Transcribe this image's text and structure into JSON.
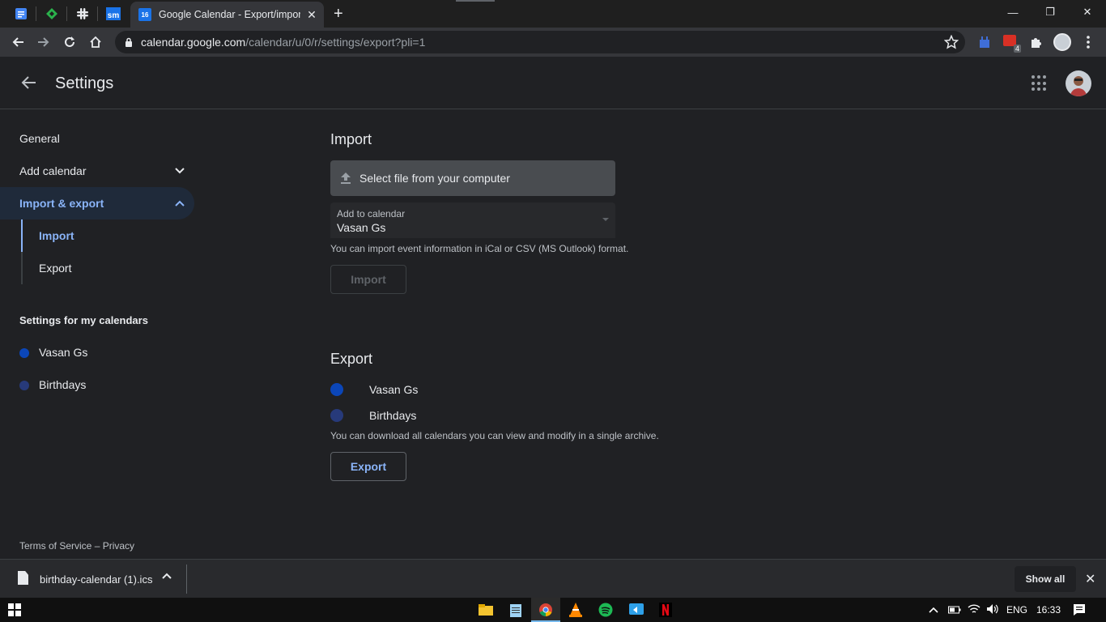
{
  "browser": {
    "active_tab": {
      "title": "Google Calendar - Export/import",
      "favicon_text": "16",
      "close_label": "✕"
    },
    "new_tab_label": "+",
    "pinned_tabs": [
      "docs-icon",
      "feedly-icon",
      "slack-icon",
      "sm-icon"
    ],
    "pinned_sm_text": "sm",
    "url_host": "calendar.google.com",
    "url_path": "/calendar/u/0/r/settings/export?pli=1",
    "extension_badge": "4",
    "window_controls": {
      "minimize": "—",
      "restore": "❐",
      "close": "✕"
    }
  },
  "header": {
    "title": "Settings"
  },
  "sidebar": {
    "general": "General",
    "add_calendar": "Add calendar",
    "import_export": "Import & export",
    "import": "Import",
    "export": "Export",
    "settings_heading": "Settings for my calendars",
    "calendars": [
      {
        "name": "Vasan Gs",
        "color": "#0b46b8"
      },
      {
        "name": "Birthdays",
        "color": "#273a7a"
      }
    ]
  },
  "import_section": {
    "title": "Import",
    "file_button": "Select file from your computer",
    "add_to_label": "Add to calendar",
    "add_to_value": "Vasan Gs",
    "hint": "You can import event information in iCal or CSV (MS Outlook) format.",
    "button": "Import"
  },
  "export_section": {
    "title": "Export",
    "calendars": [
      {
        "name": "Vasan Gs",
        "color": "#0b46b8"
      },
      {
        "name": "Birthdays",
        "color": "#273a7a"
      }
    ],
    "hint": "You can download all calendars you can view and modify in a single archive.",
    "button": "Export"
  },
  "footer": {
    "terms": "Terms of Service",
    "separator": " – ",
    "privacy": "Privacy"
  },
  "download_shelf": {
    "file_name": "birthday-calendar (1).ics",
    "show_all": "Show all",
    "close_label": "✕"
  },
  "taskbar": {
    "language": "ENG",
    "time": "16:33"
  },
  "colors": {
    "accent": "#8ab4f8",
    "link_blue": "#4285f4",
    "background": "#202124"
  }
}
